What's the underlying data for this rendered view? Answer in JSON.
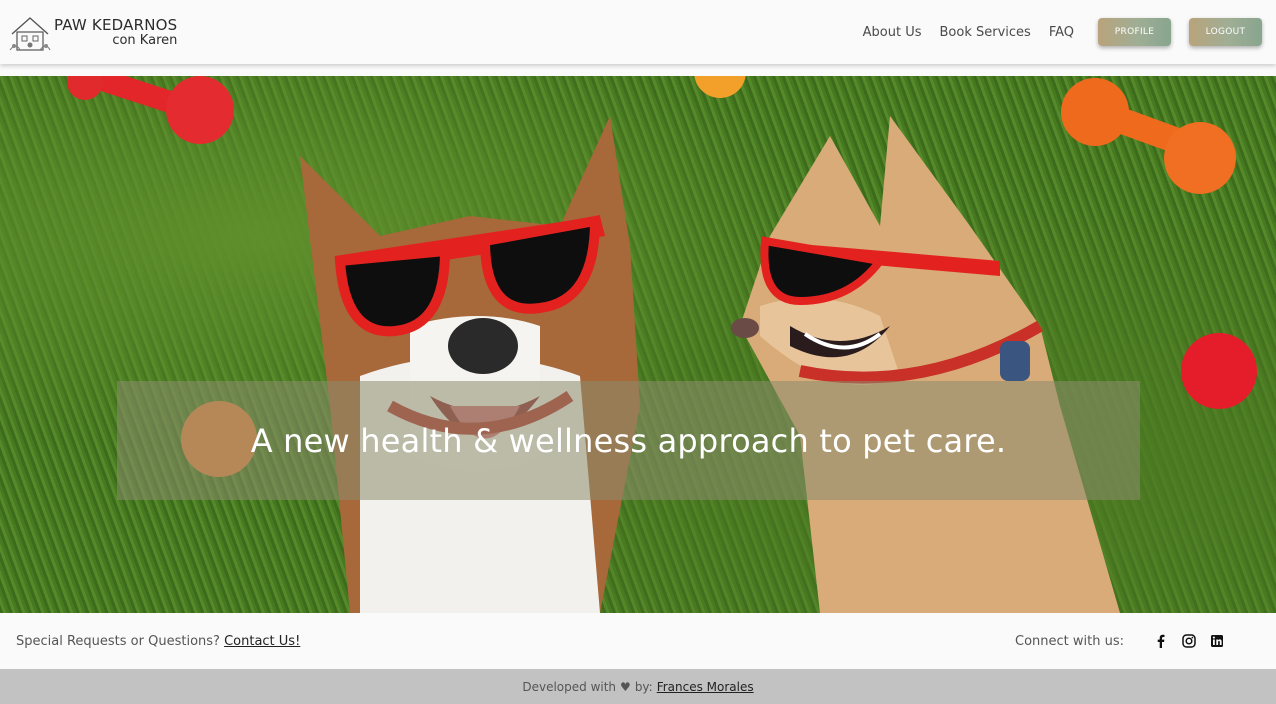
{
  "header": {
    "brand_title": "PAW KEDARNOS",
    "brand_subtitle": "con Karen",
    "logo_icon": "house-paw-logo",
    "nav": [
      {
        "label": "About Us"
      },
      {
        "label": "Book Services"
      },
      {
        "label": "FAQ"
      }
    ],
    "profile_button": "PROFILE",
    "logout_button": "LOGOUT",
    "button_gradient": [
      "#b9a37c",
      "#88a58e"
    ]
  },
  "hero": {
    "tagline": "A new health & wellness approach to pet care.",
    "image_subject": "two dogs wearing red sunglasses lying on grass with red and orange toys"
  },
  "footer": {
    "contact_prefix": "Special Requests or Questions?",
    "contact_link": "Contact Us!",
    "connect_label": "Connect with us:",
    "social_icons": [
      "facebook-icon",
      "instagram-icon",
      "linkedin-icon"
    ]
  },
  "credit": {
    "prefix": "Developed with",
    "heart_icon": "heart-icon",
    "by": "by:",
    "author": "Frances Morales"
  }
}
